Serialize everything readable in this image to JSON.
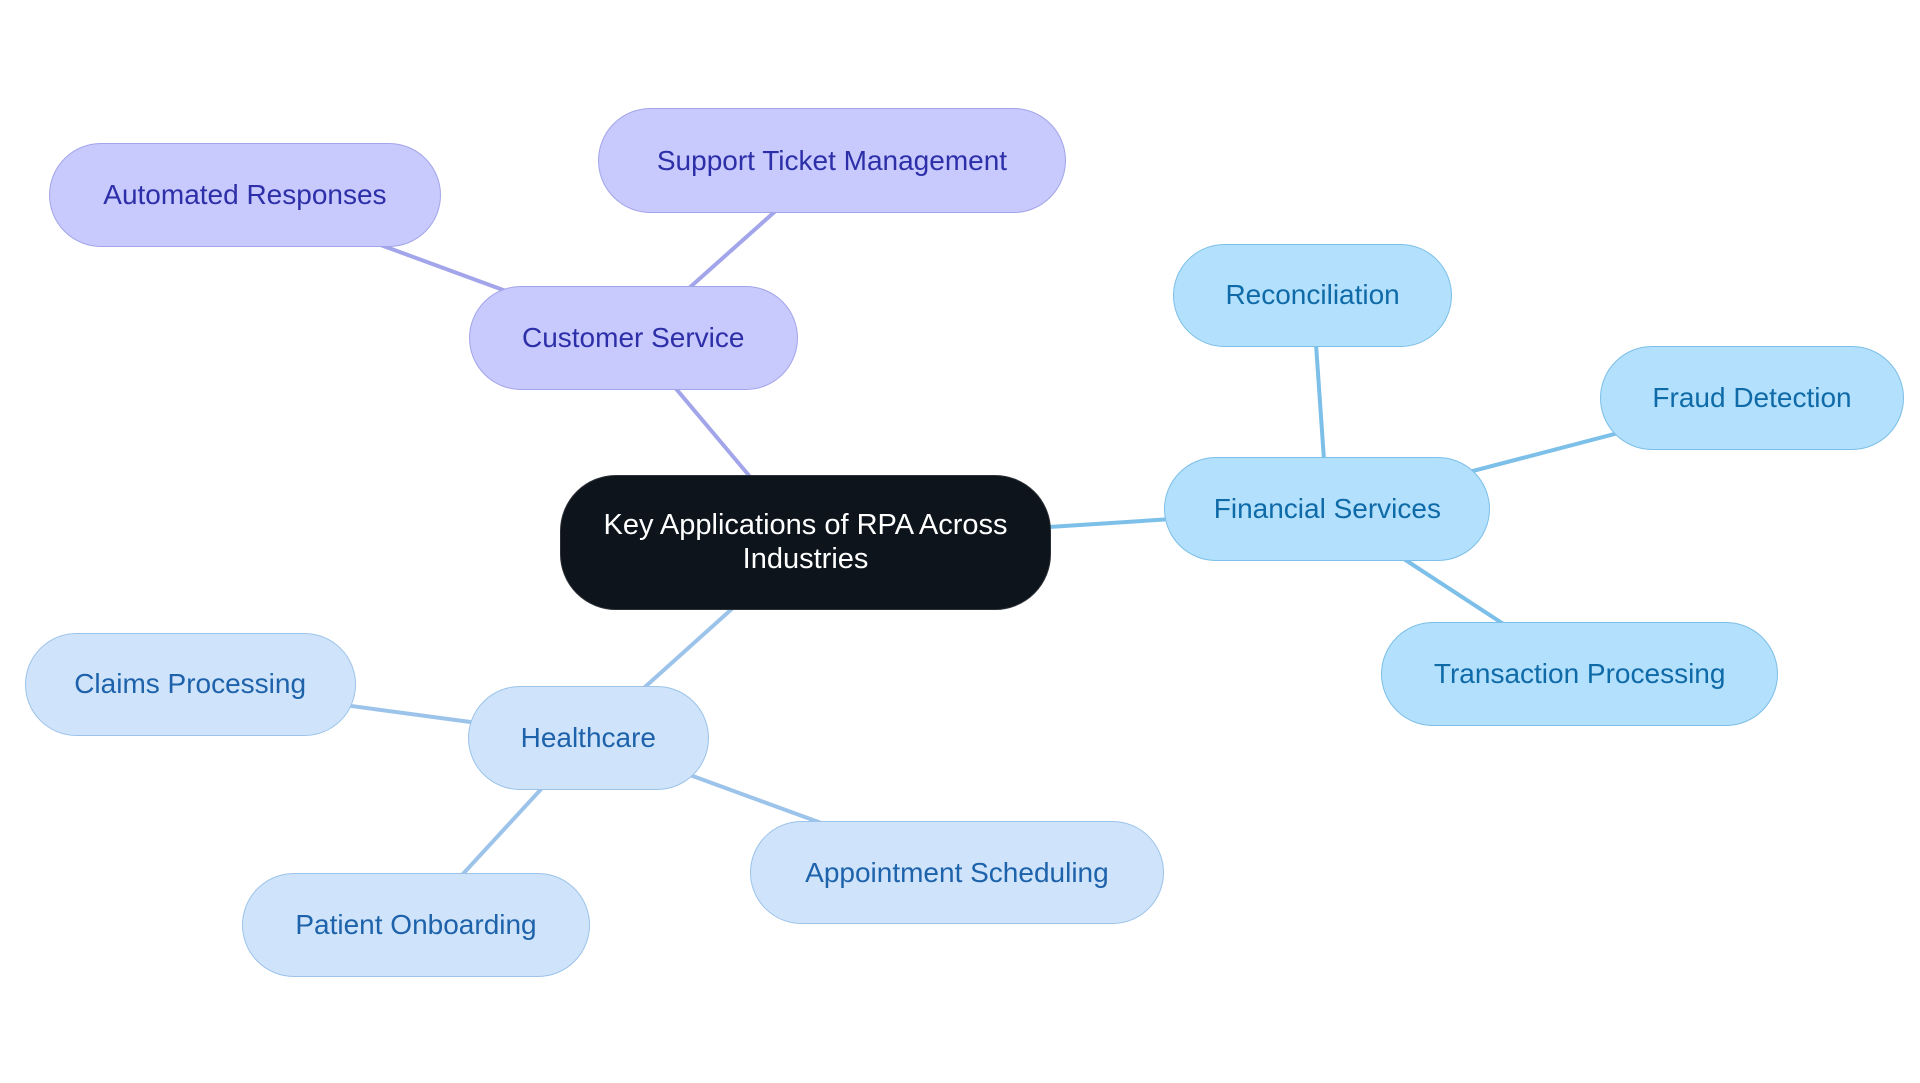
{
  "diagram": {
    "type": "mindmap",
    "root": {
      "id": "root",
      "label": "Key Applications of RPA Across Industries",
      "colors": {
        "fill": "#0d141b",
        "border": "#2b2f36",
        "text": "#ffffff"
      }
    },
    "branches": [
      {
        "id": "customer-service",
        "label": "Customer Service",
        "colors": {
          "fill": "#c8c9fc",
          "border": "#a3a5ea",
          "text": "#2d2fa8",
          "edge": "#a3a5ea"
        },
        "children": [
          {
            "id": "automated-responses",
            "label": "Automated Responses"
          },
          {
            "id": "support-ticket-management",
            "label": "Support Ticket Management"
          }
        ]
      },
      {
        "id": "financial-services",
        "label": "Financial Services",
        "colors": {
          "fill": "#b3e0fc",
          "border": "#7cbfe8",
          "text": "#0f6aa8",
          "edge": "#7cbfe8"
        },
        "children": [
          {
            "id": "reconciliation",
            "label": "Reconciliation"
          },
          {
            "id": "fraud-detection",
            "label": "Fraud Detection"
          },
          {
            "id": "transaction-processing",
            "label": "Transaction Processing"
          }
        ]
      },
      {
        "id": "healthcare",
        "label": "Healthcare",
        "colors": {
          "fill": "#cfe4fa",
          "border": "#9cc3ea",
          "text": "#1d62aa",
          "edge": "#9cc3ea"
        },
        "children": [
          {
            "id": "claims-processing",
            "label": "Claims Processing"
          },
          {
            "id": "patient-onboarding",
            "label": "Patient Onboarding"
          },
          {
            "id": "appointment-scheduling",
            "label": "Appointment Scheduling"
          }
        ]
      }
    ]
  }
}
